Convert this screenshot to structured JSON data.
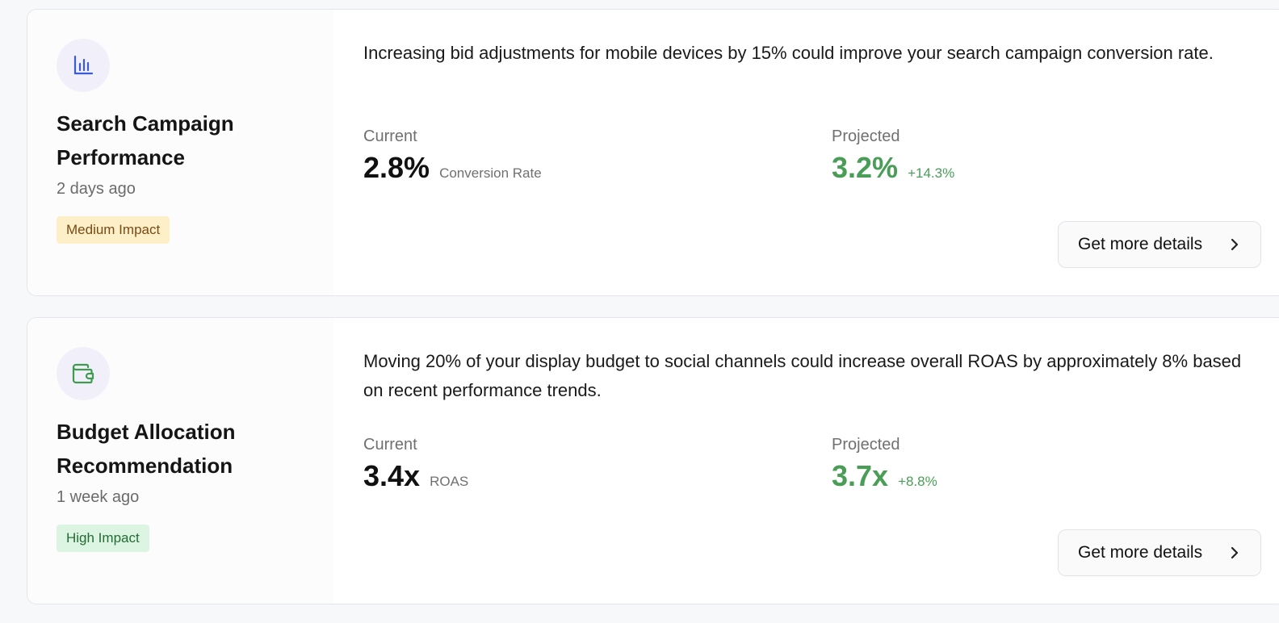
{
  "recommendations": [
    {
      "icon": "bar-chart-icon",
      "icon_color": "#3b5bdb",
      "title": "Search Campaign Performance",
      "time": "2 days ago",
      "impact": "Medium Impact",
      "impact_level": "medium",
      "description": "Increasing bid adjustments for mobile devices by 15% could improve your search campaign conversion rate.",
      "current_label": "Current",
      "current_value": "2.8%",
      "current_unit": "Conversion Rate",
      "projected_label": "Projected",
      "projected_value": "3.2%",
      "projected_delta": "+14.3%",
      "button_label": "Get more details"
    },
    {
      "icon": "wallet-icon",
      "icon_color": "#3f9a4e",
      "title": "Budget Allocation Recommendation",
      "time": "1 week ago",
      "impact": "High Impact",
      "impact_level": "high",
      "description": "Moving 20% of your display budget to social channels could increase overall ROAS by approximately 8% based on recent performance trends.",
      "current_label": "Current",
      "current_value": "3.4x",
      "current_unit": "ROAS",
      "projected_label": "Projected",
      "projected_value": "3.7x",
      "projected_delta": "+8.8%",
      "button_label": "Get more details"
    }
  ],
  "colors": {
    "positive": "#4a9d57",
    "medium_badge_bg": "#fdf0c8",
    "high_badge_bg": "#dcf5e2"
  }
}
